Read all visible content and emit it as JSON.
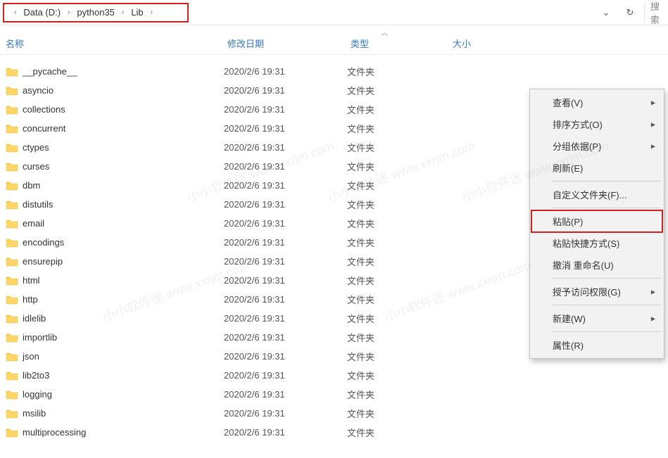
{
  "breadcrumb": {
    "items": [
      "Data (D:)",
      "python35",
      "Lib"
    ]
  },
  "search": {
    "placeholder": "搜索"
  },
  "columns": {
    "name": "名称",
    "date": "修改日期",
    "type": "类型",
    "size": "大小"
  },
  "files": [
    {
      "name": "__pycache__",
      "date": "2020/2/6 19:31",
      "type": "文件夹"
    },
    {
      "name": "asyncio",
      "date": "2020/2/6 19:31",
      "type": "文件夹"
    },
    {
      "name": "collections",
      "date": "2020/2/6 19:31",
      "type": "文件夹"
    },
    {
      "name": "concurrent",
      "date": "2020/2/6 19:31",
      "type": "文件夹"
    },
    {
      "name": "ctypes",
      "date": "2020/2/6 19:31",
      "type": "文件夹"
    },
    {
      "name": "curses",
      "date": "2020/2/6 19:31",
      "type": "文件夹"
    },
    {
      "name": "dbm",
      "date": "2020/2/6 19:31",
      "type": "文件夹"
    },
    {
      "name": "distutils",
      "date": "2020/2/6 19:31",
      "type": "文件夹"
    },
    {
      "name": "email",
      "date": "2020/2/6 19:31",
      "type": "文件夹"
    },
    {
      "name": "encodings",
      "date": "2020/2/6 19:31",
      "type": "文件夹"
    },
    {
      "name": "ensurepip",
      "date": "2020/2/6 19:31",
      "type": "文件夹"
    },
    {
      "name": "html",
      "date": "2020/2/6 19:31",
      "type": "文件夹"
    },
    {
      "name": "http",
      "date": "2020/2/6 19:31",
      "type": "文件夹"
    },
    {
      "name": "idlelib",
      "date": "2020/2/6 19:31",
      "type": "文件夹"
    },
    {
      "name": "importlib",
      "date": "2020/2/6 19:31",
      "type": "文件夹"
    },
    {
      "name": "json",
      "date": "2020/2/6 19:31",
      "type": "文件夹"
    },
    {
      "name": "lib2to3",
      "date": "2020/2/6 19:31",
      "type": "文件夹"
    },
    {
      "name": "logging",
      "date": "2020/2/6 19:31",
      "type": "文件夹"
    },
    {
      "name": "msilib",
      "date": "2020/2/6 19:31",
      "type": "文件夹"
    },
    {
      "name": "multiprocessing",
      "date": "2020/2/6 19:31",
      "type": "文件夹"
    }
  ],
  "context_menu": [
    {
      "label": "查看(V)",
      "sub": true
    },
    {
      "label": "排序方式(O)",
      "sub": true
    },
    {
      "label": "分组依据(P)",
      "sub": true
    },
    {
      "label": "刷新(E)"
    },
    {
      "sep": true
    },
    {
      "label": "自定义文件夹(F)..."
    },
    {
      "sep": true
    },
    {
      "label": "粘贴(P)",
      "highlighted": true
    },
    {
      "label": "粘贴快捷方式(S)"
    },
    {
      "label": "撤消 重命名(U)"
    },
    {
      "sep": true
    },
    {
      "label": "授予访问权限(G)",
      "sub": true
    },
    {
      "sep": true
    },
    {
      "label": "新建(W)",
      "sub": true
    },
    {
      "sep": true
    },
    {
      "label": "属性(R)"
    }
  ],
  "watermarks": [
    "小小软件迷 www.xxrjm.com",
    "小小软件迷 www.xxrjm.com",
    "小小软件迷 www.xxrjm.com"
  ]
}
